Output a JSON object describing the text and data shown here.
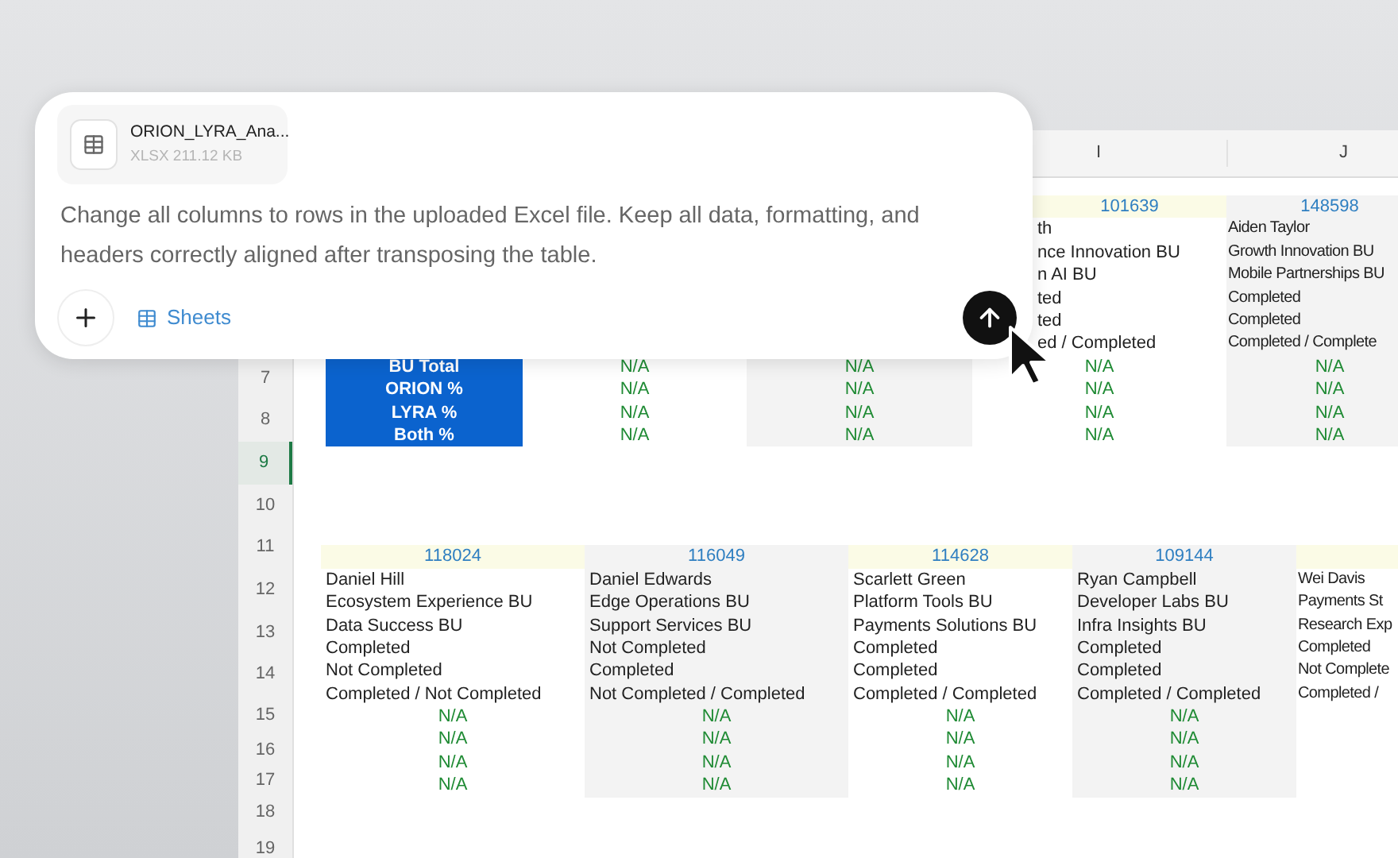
{
  "spreadsheet": {
    "column_headers": [
      "I",
      "J"
    ],
    "row_numbers": [
      {
        "label": "7",
        "selected": false
      },
      {
        "label": "8",
        "selected": false
      },
      {
        "label": "9",
        "selected": true
      },
      {
        "label": "10",
        "selected": false
      },
      {
        "label": "11",
        "selected": false
      },
      {
        "label": "12",
        "selected": false
      },
      {
        "label": "13",
        "selected": false
      },
      {
        "label": "14",
        "selected": false
      },
      {
        "label": "15",
        "selected": false
      },
      {
        "label": "16",
        "selected": false
      },
      {
        "label": "17",
        "selected": false
      },
      {
        "label": "18",
        "selected": false
      },
      {
        "label": "19",
        "selected": false
      }
    ],
    "upper_block": {
      "labels": [
        "BU Total",
        "ORION %",
        "LYRA %",
        "Both %"
      ],
      "columns": [
        {
          "shaded": false,
          "values": [
            "N/A",
            "N/A",
            "N/A",
            "N/A"
          ]
        },
        {
          "shaded": true,
          "values": [
            "N/A",
            "N/A",
            "N/A",
            "N/A"
          ]
        },
        {
          "shaded": false,
          "header": "101639",
          "lines": [
            "th",
            "nce Innovation BU",
            "n AI BU",
            "ted",
            "ted",
            "ed / Completed"
          ],
          "values": [
            "N/A",
            "N/A",
            "N/A",
            "N/A"
          ]
        },
        {
          "shaded": true,
          "header": "148598",
          "lines": [
            "Aiden Taylor",
            "Growth Innovation BU",
            "Mobile Partnerships BU",
            "Completed",
            "Completed",
            "Completed / Complete"
          ],
          "values": [
            "N/A",
            "N/A",
            "N/A",
            "N/A"
          ]
        }
      ]
    },
    "lower_block": {
      "columns": [
        {
          "shaded": false,
          "header": "118024",
          "lines": [
            "Daniel Hill",
            "Ecosystem Experience BU",
            "Data Success BU",
            "Completed",
            "Not Completed",
            "Completed / Not Completed"
          ],
          "values": [
            "N/A",
            "N/A",
            "N/A",
            "N/A"
          ]
        },
        {
          "shaded": true,
          "header": "116049",
          "lines": [
            "Daniel Edwards",
            "Edge Operations BU",
            "Support Services BU",
            "Not Completed",
            "Completed",
            "Not Completed / Completed"
          ],
          "values": [
            "N/A",
            "N/A",
            "N/A",
            "N/A"
          ]
        },
        {
          "shaded": false,
          "header": "114628",
          "lines": [
            "Scarlett Green",
            "Platform Tools BU",
            "Payments Solutions BU",
            "Completed",
            "Completed",
            "Completed / Completed"
          ],
          "values": [
            "N/A",
            "N/A",
            "N/A",
            "N/A"
          ]
        },
        {
          "shaded": true,
          "header": "109144",
          "lines": [
            "Ryan Campbell",
            "Developer Labs BU",
            "Infra Insights BU",
            "Completed",
            "Completed",
            "Completed / Completed"
          ],
          "values": [
            "N/A",
            "N/A",
            "N/A",
            "N/A"
          ]
        },
        {
          "shaded": false,
          "lines": [
            "Wei Davis",
            "Payments St",
            "Research Exp",
            "Completed",
            "Not Complete",
            "Completed /"
          ]
        }
      ]
    }
  },
  "composer": {
    "attachment": {
      "name": "ORION_LYRA_Ana...",
      "meta": "XLSX 211.12 KB"
    },
    "prompt": "Change all columns to rows in the uploaded Excel file. Keep all data, formatting, and headers correctly aligned after transposing the table.",
    "tool_button": "Sheets"
  }
}
